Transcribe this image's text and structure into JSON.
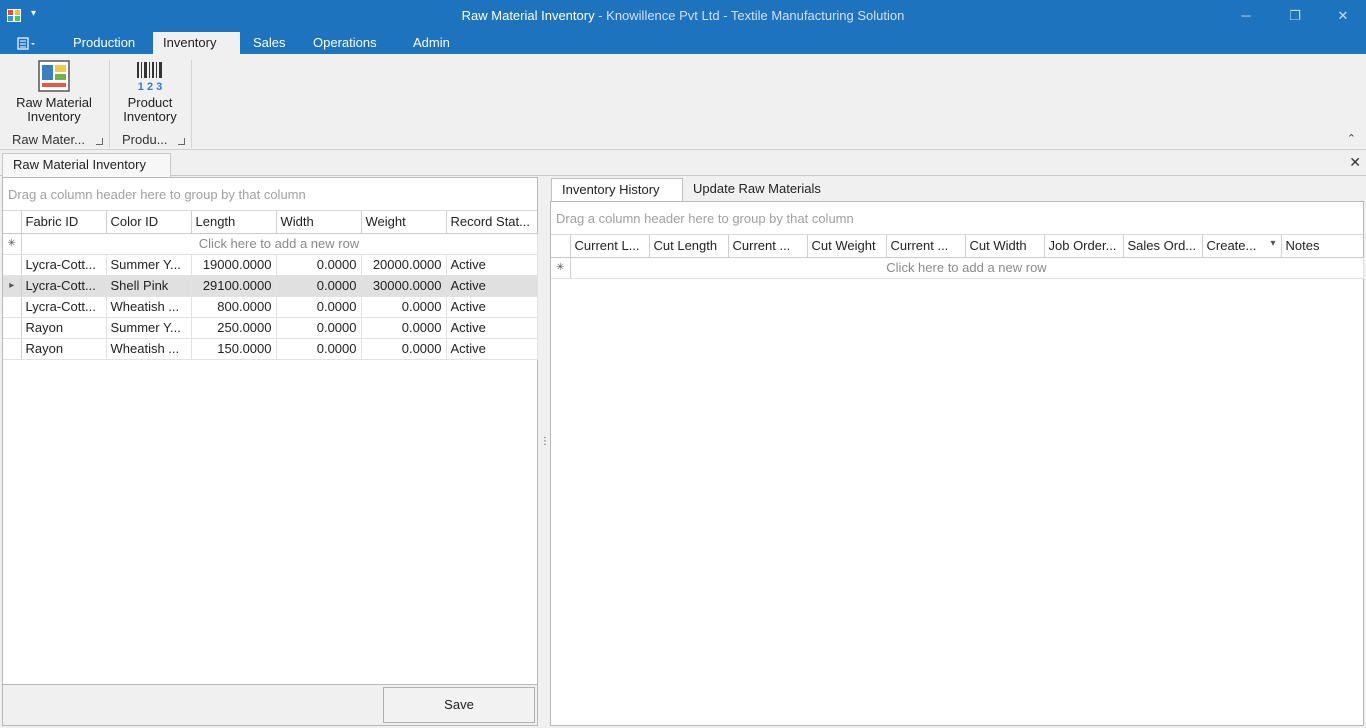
{
  "titlebar": {
    "app_title": "Raw Material Inventory",
    "subtitle": " - Knowillence Pvt Ltd - Textile Manufacturing Solution",
    "qat_symbol": "▾",
    "minimize": "─",
    "restore": "❐",
    "close": "✕"
  },
  "ribbon_tabs": [
    {
      "label": "Production"
    },
    {
      "label": "Inventory"
    },
    {
      "label": "Sales"
    },
    {
      "label": "Operations"
    },
    {
      "label": "Admin"
    }
  ],
  "ribbon": {
    "raw_material_button": {
      "line1": "Raw Material",
      "line2": "Inventory",
      "icon": "raw-material-inventory-icon"
    },
    "product_button": {
      "line1": "Product",
      "line2": "Inventory",
      "icon": "barcode-icon",
      "icon_digits": "1 2 3"
    },
    "group1_label": "Raw Mater...",
    "group2_label": "Produ...",
    "collapse_symbol": "⌃"
  },
  "document": {
    "tab_label": "Raw Material Inventory",
    "close_symbol": "✕"
  },
  "left_grid": {
    "group_hint": "Drag a column header here to group by that column",
    "columns": [
      "Fabric ID",
      "Color ID",
      "Length",
      "Width",
      "Weight",
      "Record Stat..."
    ],
    "new_row_text": "Click here to add a new row",
    "new_row_marker": "✳",
    "selected_marker": "▸",
    "rows": [
      {
        "fabric": "Lycra-Cott...",
        "color": "Summer Y...",
        "length": "19000.0000",
        "width": "0.0000",
        "weight": "20000.0000",
        "status": "Active"
      },
      {
        "fabric": "Lycra-Cott...",
        "color": "Shell Pink",
        "length": "29100.0000",
        "width": "0.0000",
        "weight": "30000.0000",
        "status": "Active"
      },
      {
        "fabric": "Lycra-Cott...",
        "color": "Wheatish ...",
        "length": "800.0000",
        "width": "0.0000",
        "weight": "0.0000",
        "status": "Active"
      },
      {
        "fabric": "Rayon",
        "color": "Summer Y...",
        "length": "250.0000",
        "width": "0.0000",
        "weight": "0.0000",
        "status": "Active"
      },
      {
        "fabric": "Rayon",
        "color": "Wheatish ...",
        "length": "150.0000",
        "width": "0.0000",
        "weight": "0.0000",
        "status": "Active"
      }
    ],
    "save_label": "Save"
  },
  "right_panel": {
    "tabs": [
      {
        "label": "Inventory History"
      },
      {
        "label": "Update Raw Materials"
      }
    ],
    "group_hint": "Drag a column header here to group by that column",
    "columns": [
      "Current L...",
      "Cut Length",
      "Current ...",
      "Cut Weight",
      "Current ...",
      "Cut Width",
      "Job Order...",
      "Sales Ord...",
      "Create...",
      "Notes"
    ],
    "sort_symbol": "▾",
    "new_row_text": "Click here to add a new row",
    "new_row_marker": "✳"
  },
  "splitter_symbol": "⋮",
  "colors": {
    "titlebar": "#1e73be",
    "selected_row": "#e0e0e0"
  }
}
